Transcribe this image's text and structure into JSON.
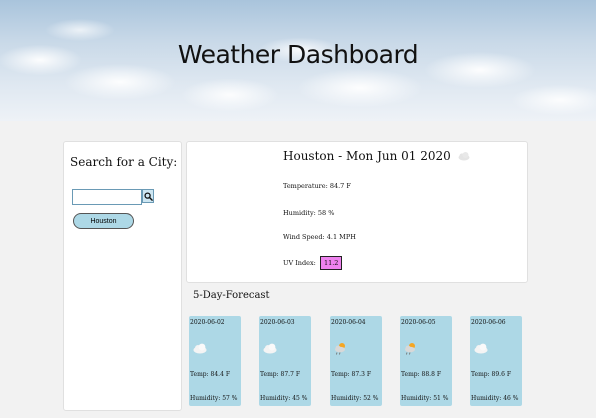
{
  "header": {
    "title": "Weather Dashboard"
  },
  "search": {
    "label": "Search for a City:",
    "input_value": "",
    "history": [
      "Houston"
    ]
  },
  "current": {
    "title": "Houston - Mon Jun 01 2020",
    "icon": "cloud-icon",
    "temperature": "Temperature: 84.7 F",
    "humidity": "Humidity: 58 %",
    "wind": "Wind Speed: 4.1 MPH",
    "uv_label": "UV Index:",
    "uv_value": "11.2",
    "uv_color": "#ee82ee"
  },
  "forecast": {
    "heading": "5-Day-Forecast",
    "card_color": "#add8e6",
    "days": [
      {
        "date": "2020-06-02",
        "icon": "cloud-icon",
        "temp": "Temp: 84.4 F",
        "humidity": "Humidity: 57 %"
      },
      {
        "date": "2020-06-03",
        "icon": "cloud-icon",
        "temp": "Temp: 87.7 F",
        "humidity": "Humidity: 45 %"
      },
      {
        "date": "2020-06-04",
        "icon": "sun-behind-rain-cloud-icon",
        "temp": "Temp: 87.3 F",
        "humidity": "Humidity: 52 %"
      },
      {
        "date": "2020-06-05",
        "icon": "sun-behind-rain-cloud-icon",
        "temp": "Temp: 88.8 F",
        "humidity": "Humidity: 51 %"
      },
      {
        "date": "2020-06-06",
        "icon": "cloud-icon",
        "temp": "Temp: 89.6 F",
        "humidity": "Humidity: 46 %"
      }
    ]
  }
}
